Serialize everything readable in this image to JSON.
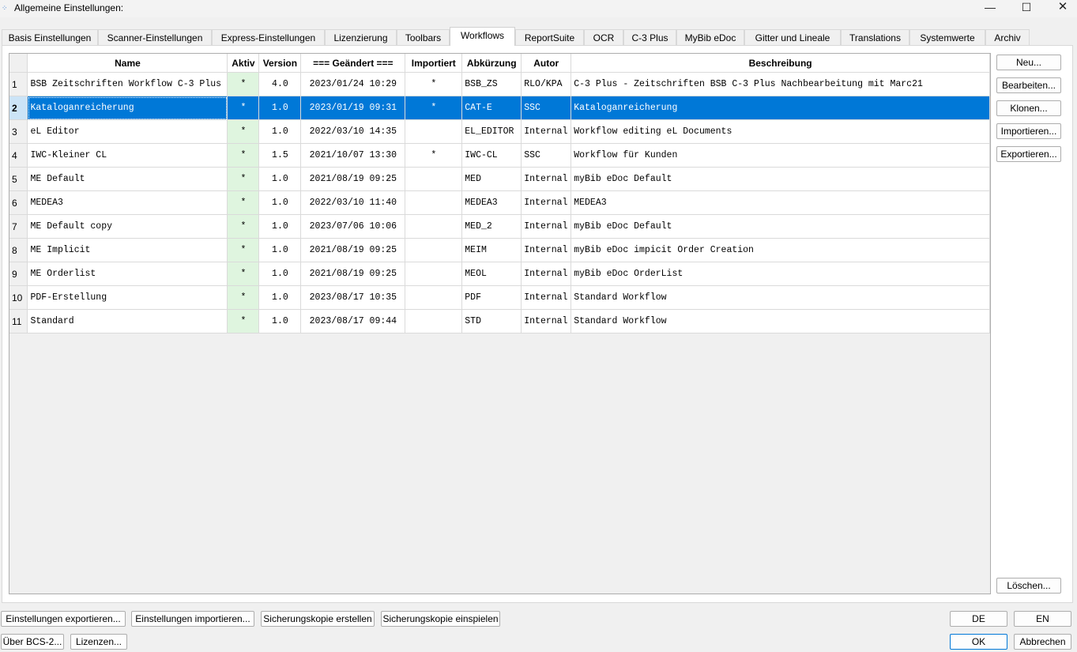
{
  "window": {
    "title": "Allgemeine Einstellungen:",
    "minimize": "—",
    "maximize": "☐",
    "close": "✕"
  },
  "tabs": [
    "Basis Einstellungen",
    "Scanner-Einstellungen",
    "Express-Einstellungen",
    "Lizenzierung",
    "Toolbars",
    "Workflows",
    "ReportSuite",
    "OCR",
    "C-3 Plus",
    "MyBib eDoc",
    "Gitter und Lineale",
    "Translations",
    "Systemwerte",
    "Archiv"
  ],
  "active_tab": "Workflows",
  "table": {
    "columns": [
      "",
      "Name",
      "Aktiv",
      "Version",
      "=== Geändert ===",
      "Importiert",
      "Abkürzung",
      "Autor",
      "Beschreibung"
    ],
    "selected_row": 2,
    "rows": [
      {
        "num": "1",
        "name": "BSB Zeitschriften Workflow C-3 Plus",
        "aktiv": "*",
        "version": "4.0",
        "geaendert": "2023/01/24 10:29",
        "importiert": "*",
        "abk": "BSB_ZS",
        "autor": "RLO/KPA",
        "beschreibung": "C-3 Plus - Zeitschriften BSB C-3 Plus Nachbearbeitung mit Marc21"
      },
      {
        "num": "2",
        "name": "Kataloganreicherung",
        "aktiv": "*",
        "version": "1.0",
        "geaendert": "2023/01/19 09:31",
        "importiert": "*",
        "abk": "CAT-E",
        "autor": "SSC",
        "beschreibung": "Kataloganreicherung"
      },
      {
        "num": "3",
        "name": "eL Editor",
        "aktiv": "*",
        "version": "1.0",
        "geaendert": "2022/03/10 14:35",
        "importiert": "",
        "abk": "EL_EDITOR",
        "autor": "Internal",
        "beschreibung": "Workflow editing eL Documents"
      },
      {
        "num": "4",
        "name": "IWC-Kleiner CL",
        "aktiv": "*",
        "version": "1.5",
        "geaendert": "2021/10/07 13:30",
        "importiert": "*",
        "abk": "IWC-CL",
        "autor": "SSC",
        "beschreibung": "Workflow für Kunden"
      },
      {
        "num": "5",
        "name": "ME Default",
        "aktiv": "*",
        "version": "1.0",
        "geaendert": "2021/08/19 09:25",
        "importiert": "",
        "abk": "MED",
        "autor": "Internal",
        "beschreibung": "myBib eDoc Default"
      },
      {
        "num": "6",
        "name": "MEDEA3",
        "aktiv": "*",
        "version": "1.0",
        "geaendert": "2022/03/10 11:40",
        "importiert": "",
        "abk": "MEDEA3",
        "autor": "Internal",
        "beschreibung": "MEDEA3"
      },
      {
        "num": "7",
        "name": "ME Default copy",
        "aktiv": "*",
        "version": "1.0",
        "geaendert": "2023/07/06 10:06",
        "importiert": "",
        "abk": "MED_2",
        "autor": "Internal",
        "beschreibung": "myBib eDoc Default"
      },
      {
        "num": "8",
        "name": "ME Implicit",
        "aktiv": "*",
        "version": "1.0",
        "geaendert": "2021/08/19 09:25",
        "importiert": "",
        "abk": "MEIM",
        "autor": "Internal",
        "beschreibung": "myBib eDoc impicit Order Creation"
      },
      {
        "num": "9",
        "name": "ME Orderlist",
        "aktiv": "*",
        "version": "1.0",
        "geaendert": "2021/08/19 09:25",
        "importiert": "",
        "abk": "MEOL",
        "autor": "Internal",
        "beschreibung": "myBib eDoc OrderList"
      },
      {
        "num": "10",
        "name": "PDF-Erstellung",
        "aktiv": "*",
        "version": "1.0",
        "geaendert": "2023/08/17 10:35",
        "importiert": "",
        "abk": "PDF",
        "autor": "Internal",
        "beschreibung": "Standard Workflow"
      },
      {
        "num": "11",
        "name": "Standard",
        "aktiv": "*",
        "version": "1.0",
        "geaendert": "2023/08/17 09:44",
        "importiert": "",
        "abk": "STD",
        "autor": "Internal",
        "beschreibung": "Standard Workflow"
      }
    ]
  },
  "side_buttons": {
    "neu": "Neu...",
    "bearbeiten": "Bearbeiten...",
    "klonen": "Klonen...",
    "importieren": "Importieren...",
    "exportieren": "Exportieren...",
    "loeschen": "Löschen..."
  },
  "footer": {
    "einstellungen_exportieren": "Einstellungen exportieren...",
    "einstellungen_importieren": "Einstellungen importieren...",
    "sicherungskopie_erstellen": "Sicherungskopie erstellen",
    "sicherungskopie_einspielen": "Sicherungskopie einspielen",
    "ueber": "Über BCS-2...",
    "lizenzen": "Lizenzen...",
    "de": "DE",
    "en": "EN",
    "ok": "OK",
    "abbrechen": "Abbrechen"
  },
  "colors": {
    "selection": "#0078d7",
    "aktiv_bg": "#dff5df"
  }
}
